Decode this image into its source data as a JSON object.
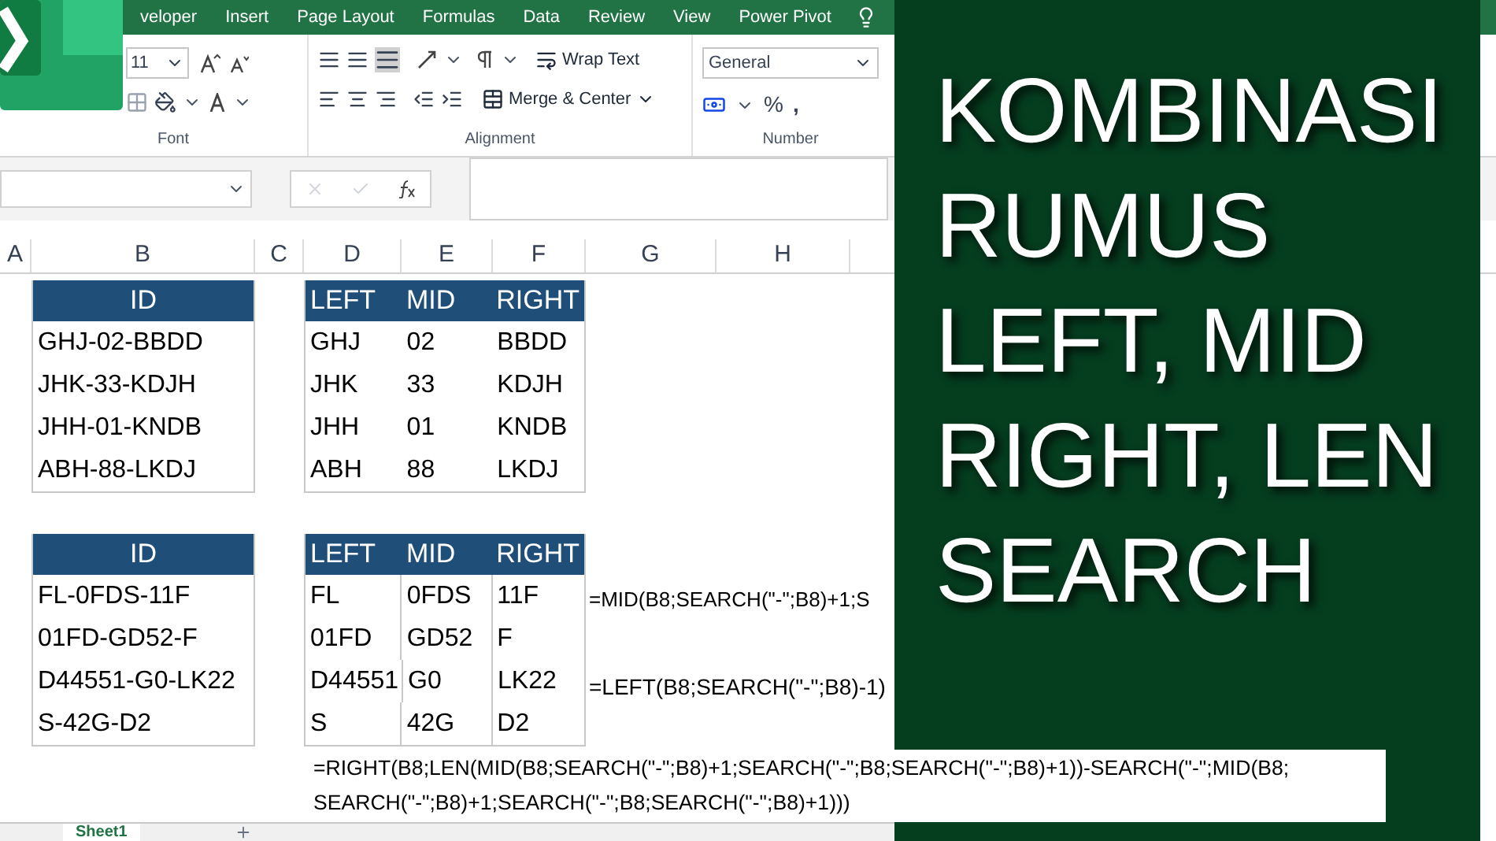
{
  "ribbon_tabs": [
    "veloper",
    "Insert",
    "Page Layout",
    "Formulas",
    "Data",
    "Review",
    "View",
    "Power Pivot"
  ],
  "ribbon": {
    "font_size": "11",
    "font_group": "Font",
    "alignment_group": "Alignment",
    "wrap_text": "Wrap Text",
    "merge_center": "Merge & Center",
    "number_format": "General",
    "number_group": "Number",
    "percent": "%",
    "comma": ","
  },
  "columns": [
    "A",
    "B",
    "C",
    "D",
    "E",
    "F",
    "G",
    "H"
  ],
  "tables": [
    {
      "id_header": "ID",
      "ids": [
        "GHJ-02-BBDD",
        "JHK-33-KDJH",
        "JHH-01-KNDB",
        "ABH-88-LKDJ"
      ],
      "headers": [
        "LEFT",
        "MID",
        "RIGHT"
      ],
      "rows": [
        [
          "GHJ",
          "02",
          "BBDD"
        ],
        [
          "JHK",
          "33",
          "KDJH"
        ],
        [
          "JHH",
          "01",
          "KNDB"
        ],
        [
          "ABH",
          "88",
          "LKDJ"
        ]
      ]
    },
    {
      "id_header": "ID",
      "ids": [
        "FL-0FDS-11F",
        "01FD-GD52-F",
        "D44551-G0-LK22",
        "S-42G-D2"
      ],
      "headers": [
        "LEFT",
        "MID",
        "RIGHT"
      ],
      "rows": [
        [
          "FL",
          "0FDS",
          "11F"
        ],
        [
          "01FD",
          "GD52",
          "F"
        ],
        [
          "D44551",
          "G0",
          "LK22"
        ],
        [
          "S",
          "42G",
          "D2"
        ]
      ]
    }
  ],
  "formulas": {
    "mid": "=MID(B8;SEARCH(\"-\";B8)+1;S",
    "left": "=LEFT(B8;SEARCH(\"-\";B8)-1)",
    "right": [
      "=RIGHT(B8;LEN(MID(B8;SEARCH(\"-\";B8)+1;SEARCH(\"-\";B8;SEARCH(\"-\";B8)+1))-SEARCH(\"-\";MID(B8;",
      "SEARCH(\"-\";B8)+1;SEARCH(\"-\";B8;SEARCH(\"-\";B8)+1)))"
    ]
  },
  "title_lines": [
    "KOMBINASI",
    "RUMUS",
    "LEFT, MID",
    "RIGHT, LEN",
    "SEARCH"
  ],
  "sheet_tabs": [
    {
      "label": "Sheet1",
      "selected": true
    }
  ]
}
